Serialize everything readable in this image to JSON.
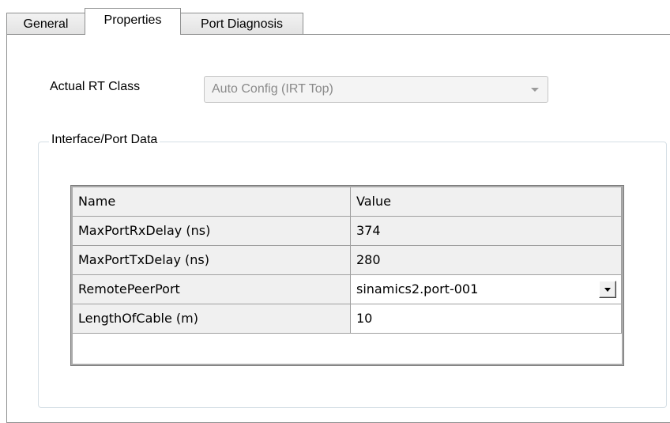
{
  "tabs": [
    {
      "label": "General"
    },
    {
      "label": "Properties",
      "active": true
    },
    {
      "label": "Port Diagnosis"
    }
  ],
  "rt_class": {
    "label": "Actual RT Class",
    "value": "Auto Config (IRT Top)"
  },
  "group": {
    "title": "Interface/Port Data"
  },
  "table": {
    "headers": [
      "Name",
      "Value"
    ],
    "rows": [
      {
        "name": "MaxPortRxDelay (ns)",
        "value": "374"
      },
      {
        "name": "MaxPortTxDelay (ns)",
        "value": "280"
      },
      {
        "name": "RemotePeerPort",
        "value": "sinamics2.port-001"
      },
      {
        "name": "LengthOfCable (m)",
        "value": "10"
      }
    ]
  }
}
